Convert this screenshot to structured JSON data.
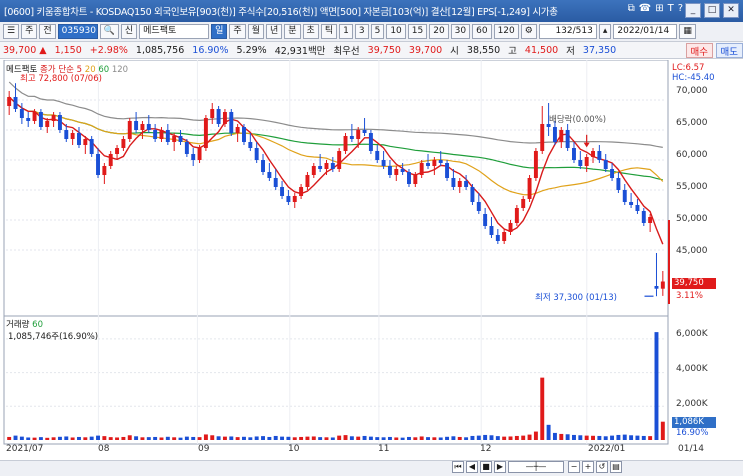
{
  "window": {
    "title": "[0600] 키움종합차트 - KOSDAQ150 외국인보유[903(천)] 주식수[20,516(천)] 액면[500] 자본금[103(억)] 결산[12월] EPS[-1,249] 시가총",
    "icons": [
      "window-list-icon",
      "alert-icon",
      "pin-icon",
      "text-icon",
      "help-icon"
    ]
  },
  "toolbar": {
    "mode1": "주",
    "mode2": "전",
    "code": "035930",
    "prefix": "신",
    "stock_name": "메드팩토",
    "periods": [
      "일",
      "주",
      "월",
      "년",
      "분",
      "초",
      "틱"
    ],
    "active_period": "일",
    "intervals": [
      "1",
      "3",
      "5",
      "10",
      "15",
      "20",
      "30",
      "60",
      "120"
    ],
    "count": "132/513",
    "date": "2022/01/14"
  },
  "quote": {
    "price": "39,700",
    "change": "1,150",
    "change_pct": "+2.98%",
    "volume": "1,085,756",
    "turnover_pct": "16.90%",
    "ratio": "5.29%",
    "amount": "42,931백만",
    "best_ask_label": "최우선",
    "ask": "39,750",
    "bid": "39,700",
    "open_label": "시",
    "open": "38,550",
    "high_label": "고",
    "high": "41,500",
    "low_label": "저",
    "low": "37,350",
    "buy_label": "매수",
    "sell_label": "매도"
  },
  "price_panel": {
    "name": "메드팩토",
    "ma_label": "종가 단순",
    "ma_periods": [
      "5",
      "20",
      "60",
      "120"
    ],
    "max_label": "최고 72,800 (07/06)",
    "min_label": "최저 37,300 (01/13)",
    "dividend_label": "배당락(0.00%)",
    "lc": "LC:6.57",
    "hc": "HC:-45.40",
    "last_price": "39,750",
    "last_pct": "3.11%",
    "y_ticks": [
      "70,000",
      "65,000",
      "60,000",
      "55,000",
      "50,000",
      "45,000"
    ]
  },
  "volume_panel": {
    "label": "거래량",
    "ma": "60",
    "value_label": "1,085,746주(16.90%)",
    "last_volume": "1,086K",
    "last_pct": "16.90%",
    "y_ticks": [
      "6,000K",
      "4,000K",
      "2,000K"
    ]
  },
  "x_axis": [
    "2021/07",
    "08",
    "09",
    "10",
    "11",
    "12",
    "2022/01",
    "01/14"
  ],
  "colors": {
    "up": "#e01a1a",
    "down": "#1a4fd6",
    "ma5": "#d81b1b",
    "ma20": "#e0a21a",
    "ma60": "#1f9e3a",
    "ma120": "#8c8c8c"
  },
  "chart_data": {
    "type": "candlestick",
    "dates_start": "2021/07",
    "dates_end": "2022/01/14",
    "ohlc": [
      [
        69000,
        71500,
        67500,
        70500
      ],
      [
        70500,
        72800,
        68000,
        68500
      ],
      [
        68500,
        69500,
        66000,
        67000
      ],
      [
        67000,
        68000,
        65500,
        66500
      ],
      [
        66500,
        68500,
        66000,
        68000
      ],
      [
        68000,
        68500,
        65000,
        65500
      ],
      [
        65500,
        67000,
        64500,
        66500
      ],
      [
        66500,
        68000,
        65500,
        67500
      ],
      [
        67500,
        68000,
        64500,
        65000
      ],
      [
        65000,
        66000,
        63000,
        63500
      ],
      [
        63500,
        65000,
        62500,
        64500
      ],
      [
        64500,
        65500,
        62000,
        62500
      ],
      [
        62500,
        64000,
        61000,
        63500
      ],
      [
        63500,
        64000,
        60500,
        61000
      ],
      [
        61000,
        62000,
        57000,
        57500
      ],
      [
        57500,
        59500,
        56000,
        59000
      ],
      [
        59000,
        61500,
        58500,
        61000
      ],
      [
        61000,
        62500,
        60000,
        62000
      ],
      [
        62000,
        64000,
        61500,
        63500
      ],
      [
        63500,
        67000,
        63000,
        66500
      ],
      [
        66500,
        68000,
        64500,
        65000
      ],
      [
        65000,
        66500,
        63500,
        66000
      ],
      [
        66000,
        67500,
        64500,
        65000
      ],
      [
        65000,
        66000,
        63000,
        63500
      ],
      [
        63500,
        65500,
        63000,
        65000
      ],
      [
        65000,
        66000,
        62500,
        63000
      ],
      [
        63000,
        64500,
        61500,
        64000
      ],
      [
        64000,
        65000,
        62500,
        63000
      ],
      [
        63000,
        63500,
        60500,
        61000
      ],
      [
        61000,
        62000,
        59000,
        60000
      ],
      [
        60000,
        62500,
        59500,
        62000
      ],
      [
        62000,
        67500,
        61500,
        67000
      ],
      [
        67000,
        69500,
        66000,
        68500
      ],
      [
        68500,
        69000,
        65500,
        66000
      ],
      [
        66000,
        68500,
        65500,
        68000
      ],
      [
        68000,
        68500,
        64000,
        64500
      ],
      [
        64500,
        66000,
        63000,
        65500
      ],
      [
        65500,
        66000,
        62500,
        63000
      ],
      [
        63000,
        64500,
        61500,
        62000
      ],
      [
        62000,
        63000,
        59500,
        60000
      ],
      [
        60000,
        61000,
        57500,
        58000
      ],
      [
        58000,
        59500,
        56500,
        57000
      ],
      [
        57000,
        58500,
        55000,
        55500
      ],
      [
        55500,
        56500,
        53500,
        54000
      ],
      [
        54000,
        55000,
        52500,
        53000
      ],
      [
        53000,
        54500,
        52000,
        54000
      ],
      [
        54000,
        56000,
        53500,
        55500
      ],
      [
        55500,
        58000,
        55000,
        57500
      ],
      [
        57500,
        59500,
        57000,
        59000
      ],
      [
        59000,
        61000,
        58000,
        58500
      ],
      [
        58500,
        60000,
        57500,
        59500
      ],
      [
        59500,
        60500,
        58000,
        58500
      ],
      [
        58500,
        62000,
        58000,
        61500
      ],
      [
        61500,
        64500,
        61000,
        64000
      ],
      [
        64000,
        66000,
        63000,
        63500
      ],
      [
        63500,
        65500,
        62000,
        65000
      ],
      [
        65000,
        67000,
        64000,
        64500
      ],
      [
        64500,
        65000,
        61000,
        61500
      ],
      [
        61500,
        62500,
        59500,
        60000
      ],
      [
        60000,
        61500,
        58500,
        59000
      ],
      [
        59000,
        60000,
        57000,
        57500
      ],
      [
        57500,
        59000,
        56500,
        58500
      ],
      [
        58500,
        59500,
        57500,
        58000
      ],
      [
        58000,
        58500,
        55500,
        56000
      ],
      [
        56000,
        58000,
        55500,
        57500
      ],
      [
        57500,
        60000,
        57000,
        59500
      ],
      [
        59500,
        61000,
        58500,
        59000
      ],
      [
        59000,
        60500,
        57500,
        60000
      ],
      [
        60000,
        61500,
        59000,
        59500
      ],
      [
        59500,
        60000,
        56500,
        57000
      ],
      [
        57000,
        58500,
        55000,
        55500
      ],
      [
        55500,
        57000,
        54500,
        56500
      ],
      [
        56500,
        57500,
        55000,
        55500
      ],
      [
        55500,
        56000,
        52500,
        53000
      ],
      [
        53000,
        54500,
        51000,
        51500
      ],
      [
        51000,
        52000,
        48500,
        49000
      ],
      [
        49000,
        50500,
        47000,
        47500
      ],
      [
        47500,
        48500,
        46000,
        46500
      ],
      [
        46500,
        48500,
        46000,
        48000
      ],
      [
        48000,
        50000,
        47500,
        49500
      ],
      [
        49500,
        52500,
        49000,
        52000
      ],
      [
        52000,
        54000,
        51500,
        53500
      ],
      [
        53500,
        57500,
        53000,
        57000
      ],
      [
        57000,
        62000,
        56500,
        61500
      ],
      [
        61500,
        69000,
        61000,
        66000
      ],
      [
        66000,
        69500,
        64000,
        65500
      ],
      [
        65500,
        66500,
        62500,
        63000
      ],
      [
        63000,
        65500,
        62000,
        65000
      ],
      [
        65000,
        66000,
        61500,
        62000
      ],
      [
        62000,
        63000,
        59500,
        60000
      ],
      [
        60000,
        61500,
        58500,
        59000
      ],
      [
        59000,
        61000,
        58000,
        60500
      ],
      [
        60500,
        62000,
        59500,
        61500
      ],
      [
        61500,
        62500,
        59500,
        60000
      ],
      [
        60000,
        61000,
        58000,
        58500
      ],
      [
        58500,
        59500,
        56500,
        57000
      ],
      [
        57000,
        58000,
        54500,
        55000
      ],
      [
        55000,
        56000,
        52500,
        53000
      ],
      [
        53000,
        54500,
        52000,
        52500
      ],
      [
        52500,
        53500,
        51000,
        51500
      ],
      [
        51500,
        52000,
        49000,
        49500
      ],
      [
        49500,
        51000,
        48000,
        50500
      ],
      [
        39000,
        44500,
        37300,
        38550
      ],
      [
        38550,
        41500,
        37350,
        39750
      ]
    ],
    "volume_k": [
      180,
      260,
      200,
      150,
      140,
      170,
      130,
      160,
      190,
      210,
      150,
      180,
      160,
      200,
      260,
      230,
      170,
      150,
      180,
      280,
      220,
      160,
      170,
      180,
      150,
      190,
      160,
      140,
      200,
      180,
      170,
      330,
      280,
      220,
      200,
      210,
      170,
      190,
      160,
      210,
      230,
      180,
      240,
      200,
      190,
      160,
      180,
      200,
      210,
      170,
      160,
      150,
      260,
      290,
      220,
      200,
      240,
      200,
      170,
      160,
      180,
      150,
      140,
      180,
      160,
      210,
      170,
      160,
      150,
      190,
      220,
      180,
      160,
      240,
      260,
      300,
      280,
      230,
      200,
      210,
      240,
      260,
      320,
      500,
      3700,
      900,
      420,
      360,
      340,
      300,
      280,
      260,
      250,
      240,
      220,
      260,
      300,
      320,
      280,
      260,
      240,
      230,
      6400,
      1086
    ],
    "ylim": [
      35000,
      75000
    ],
    "vol_ylim": [
      0,
      7000
    ]
  }
}
